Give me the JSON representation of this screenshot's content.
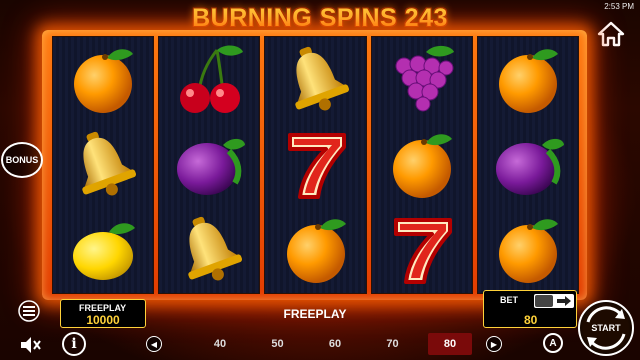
{
  "game": {
    "title": "BURNING SPINS 243",
    "clock": "2:53 PM"
  },
  "reels": [
    [
      "orange",
      "bell",
      "lemon"
    ],
    [
      "cherry",
      "plum",
      "bell"
    ],
    [
      "bell",
      "seven",
      "orange"
    ],
    [
      "grapes",
      "orange",
      "seven"
    ],
    [
      "orange",
      "plum",
      "orange"
    ]
  ],
  "controls": {
    "bonus_label": "BONUS",
    "info_label": "i",
    "auto_label": "A",
    "start_label": "START"
  },
  "freeplay": {
    "label": "FREEPLAY",
    "value": "10000"
  },
  "status": {
    "text": "FREEPLAY"
  },
  "bet": {
    "label": "BET",
    "value": "80"
  },
  "lines": {
    "options": [
      "40",
      "50",
      "60",
      "70",
      "80"
    ],
    "selected": "80",
    "prev_icon": "arrow-left-icon",
    "next_icon": "arrow-right-icon"
  },
  "colors": {
    "accent": "#ffd23a",
    "frame": "#ff6a00",
    "selected_bg": "#7a0a0a"
  }
}
